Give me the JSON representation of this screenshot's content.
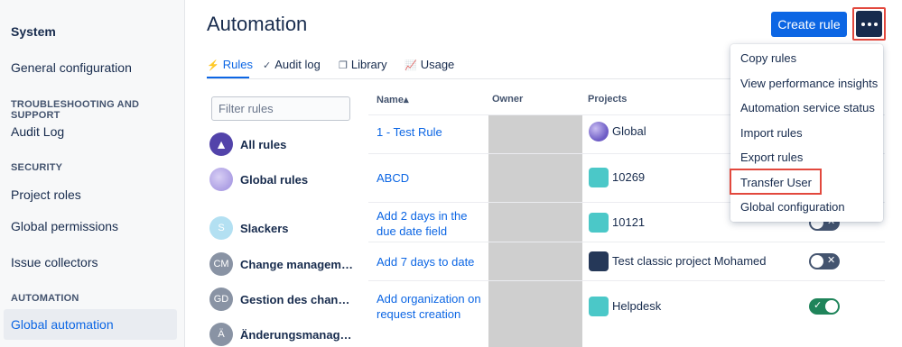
{
  "sidebar": {
    "title": "System",
    "items": [
      {
        "label": "General configuration"
      },
      {
        "heading": "TROUBLESHOOTING AND SUPPORT"
      },
      {
        "label": "Audit Log"
      },
      {
        "heading": "SECURITY"
      },
      {
        "label": "Project roles"
      },
      {
        "label": "Global permissions"
      },
      {
        "label": "Issue collectors"
      },
      {
        "heading": "AUTOMATION"
      },
      {
        "label": "Global automation",
        "active": true
      }
    ]
  },
  "header": {
    "title": "Automation",
    "create_label": "Create rule",
    "more_icon": "ellipsis-icon"
  },
  "tabs": [
    {
      "label": "Rules",
      "icon": "lightning-icon",
      "active": true
    },
    {
      "label": "Audit log",
      "icon": "check-circle-icon"
    },
    {
      "label": "Library",
      "icon": "copy-icon"
    },
    {
      "label": "Usage",
      "icon": "chart-icon"
    }
  ],
  "filter": {
    "placeholder": "Filter rules",
    "categories": [
      {
        "label": "All rules",
        "avatar": "A",
        "color": "#5243aa"
      },
      {
        "label": "Global rules",
        "avatar": "",
        "color": "#b3a6e6"
      },
      {
        "label": "Slackers",
        "avatar": "S",
        "color": "#b3e0f2"
      },
      {
        "label": "Change management",
        "avatar": "CM",
        "color": "#8993a4"
      },
      {
        "label": "Gestion des change…",
        "avatar": "GD",
        "color": "#8993a4"
      },
      {
        "label": "Änderungsmanagem…",
        "avatar": "Ä",
        "color": "#8993a4"
      }
    ]
  },
  "table": {
    "columns": [
      "Name",
      "Owner",
      "Projects"
    ],
    "sort_indicator": "▴",
    "rows": [
      {
        "name": "1 - Test Rule",
        "project": "Global",
        "enabled": null
      },
      {
        "name": "ABCD",
        "project": "10269",
        "enabled": null
      },
      {
        "name": "Add 2 days in the due date field",
        "project": "10121",
        "enabled": false
      },
      {
        "name": "Add 7 days to date",
        "project": "Test classic project Mohamed",
        "enabled": false
      },
      {
        "name": "Add organization on request creation",
        "project": "Helpdesk",
        "enabled": true
      }
    ]
  },
  "menu": {
    "items": [
      "Copy rules",
      "View performance insights",
      "Automation service status",
      "Import rules",
      "Export rules",
      "Transfer User",
      "Global configuration"
    ],
    "highlighted": "Transfer User"
  },
  "colors": {
    "accent": "#0c66e4",
    "highlight_outline": "#e2483d",
    "toggle_on": "#1f845a",
    "toggle_off": "#44546f"
  }
}
